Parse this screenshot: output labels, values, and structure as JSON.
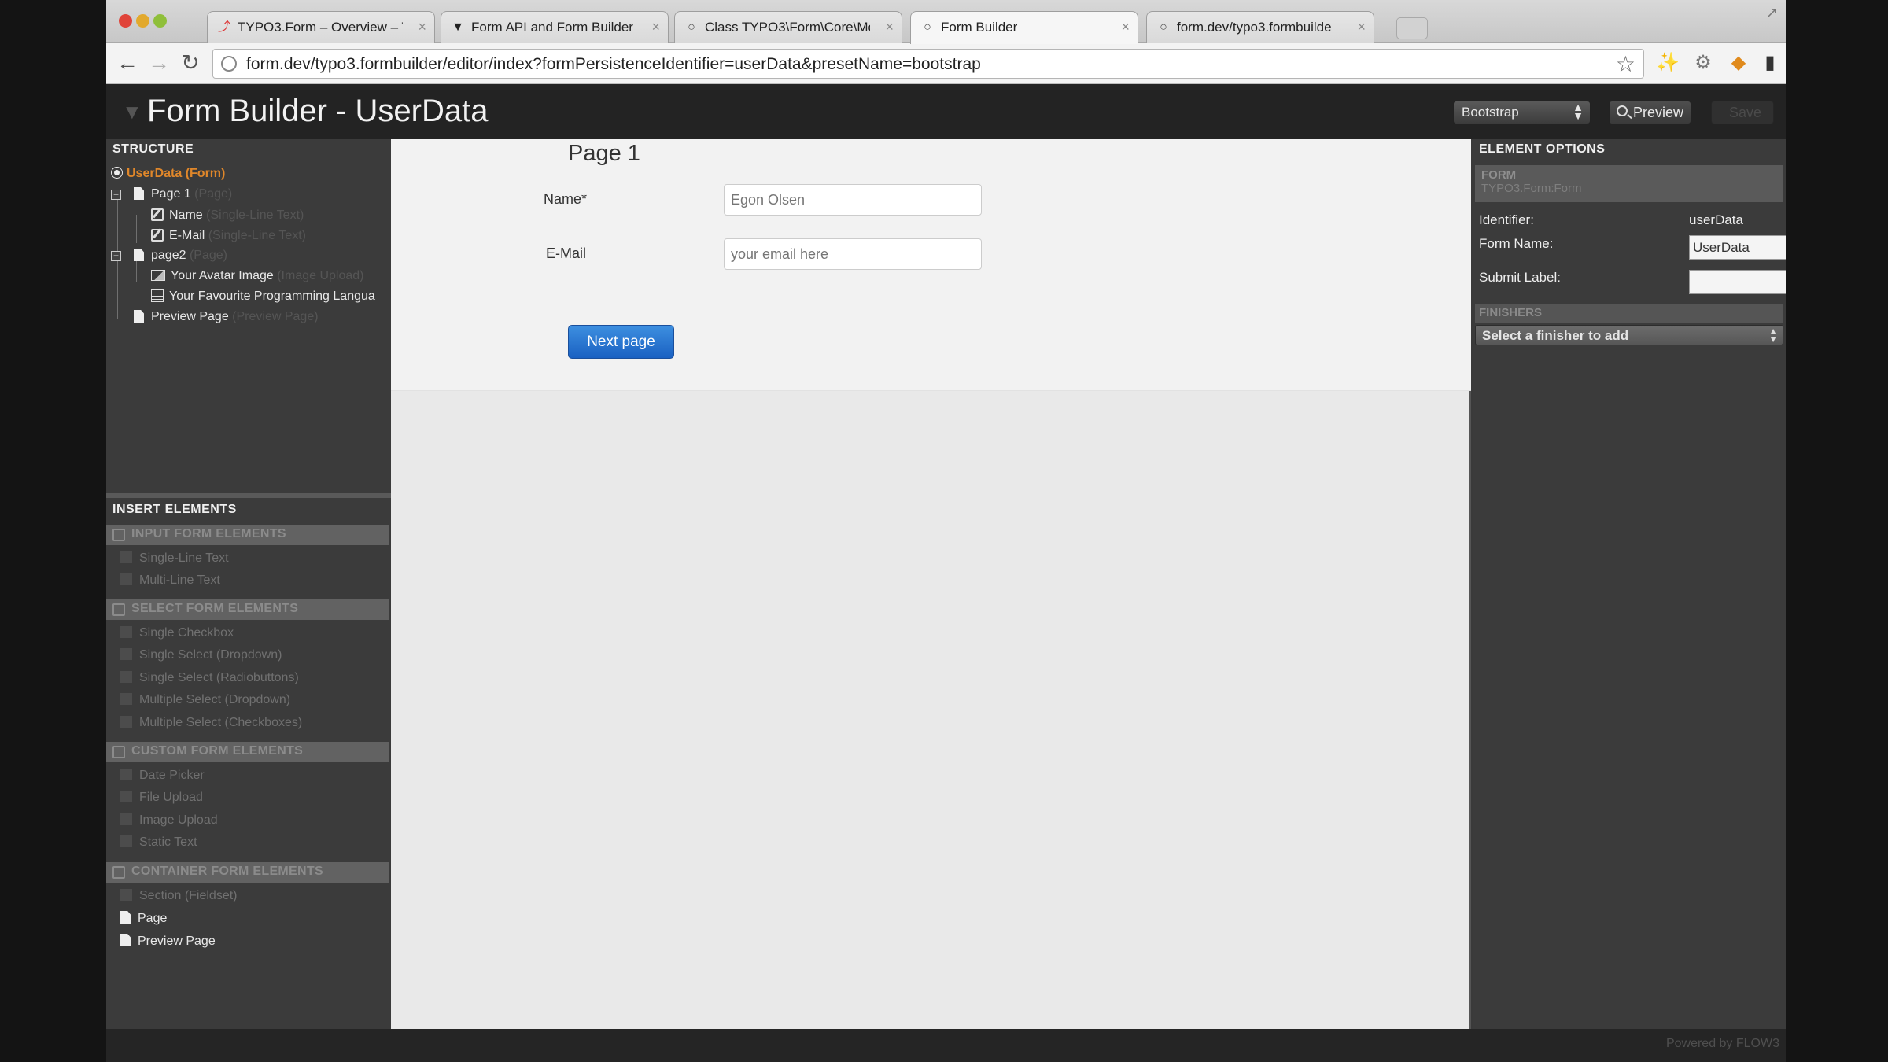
{
  "browser": {
    "tabs": [
      {
        "label": "TYPO3.Form – Overview – T",
        "favicon": "typo3-icon"
      },
      {
        "label": "Form API and Form Builder",
        "favicon": "github-icon"
      },
      {
        "label": "Class TYPO3\\Form\\Core\\Mo",
        "favicon": "globe-icon"
      },
      {
        "label": "Form Builder",
        "favicon": "globe-icon",
        "active": true
      },
      {
        "label": "form.dev/typo3.formbuilde",
        "favicon": "globe-icon"
      }
    ],
    "url": "form.dev/typo3.formbuilder/editor/index?formPersistenceIdentifier=userData&presetName=bootstrap"
  },
  "app": {
    "title": "Form Builder - UserData",
    "preset": "Bootstrap",
    "preview_label": "Preview",
    "save_label": "Save"
  },
  "structure": {
    "heading": "STRUCTURE",
    "items": [
      {
        "label": "UserData (Form)",
        "type": ""
      },
      {
        "label": "Page 1",
        "type": "(Page)"
      },
      {
        "label": "Name",
        "type": "(Single-Line Text)"
      },
      {
        "label": "E-Mail",
        "type": "(Single-Line Text)"
      },
      {
        "label": "page2",
        "type": "(Page)"
      },
      {
        "label": "Your Avatar Image",
        "type": "(Image Upload)"
      },
      {
        "label": "Your Favourite Programming Langua",
        "type": ""
      },
      {
        "label": "Preview Page",
        "type": "(Preview Page)"
      }
    ]
  },
  "insert": {
    "heading": "INSERT ELEMENTS",
    "groups": [
      {
        "label": "INPUT FORM ELEMENTS",
        "items": [
          "Single-Line Text",
          "Multi-Line Text"
        ]
      },
      {
        "label": "SELECT FORM ELEMENTS",
        "items": [
          "Single Checkbox",
          "Single Select (Dropdown)",
          "Single Select (Radiobuttons)",
          "Multiple Select (Dropdown)",
          "Multiple Select (Checkboxes)"
        ]
      },
      {
        "label": "CUSTOM FORM ELEMENTS",
        "items": [
          "Date Picker",
          "File Upload",
          "Image Upload",
          "Static Text"
        ]
      },
      {
        "label": "CONTAINER FORM ELEMENTS",
        "items": [
          "Section (Fieldset)",
          "Page",
          "Preview Page"
        ]
      }
    ]
  },
  "canvas": {
    "page_title": "Page 1",
    "fields": [
      {
        "label": "Name*",
        "placeholder": "Egon Olsen"
      },
      {
        "label": "E-Mail",
        "placeholder": "your email here"
      }
    ],
    "next_button": "Next page"
  },
  "options": {
    "heading": "ELEMENT OPTIONS",
    "type_title": "FORM",
    "type_name": "TYPO3.Form:Form",
    "identifier_label": "Identifier:",
    "identifier_value": "userData",
    "form_name_label": "Form Name:",
    "form_name_value": "UserData",
    "submit_label": "Submit Label:",
    "submit_value": "",
    "finishers_heading": "FINISHERS",
    "finisher_select": "Select a finisher to add"
  },
  "footer": {
    "powered_by": "Powered by FLOW3"
  },
  "colors": {
    "accent_orange": "#e0872a",
    "button_blue": "#1f6fd1",
    "panel_bg": "#3b3b3b",
    "canvas_bg": "#e9e9e9"
  }
}
